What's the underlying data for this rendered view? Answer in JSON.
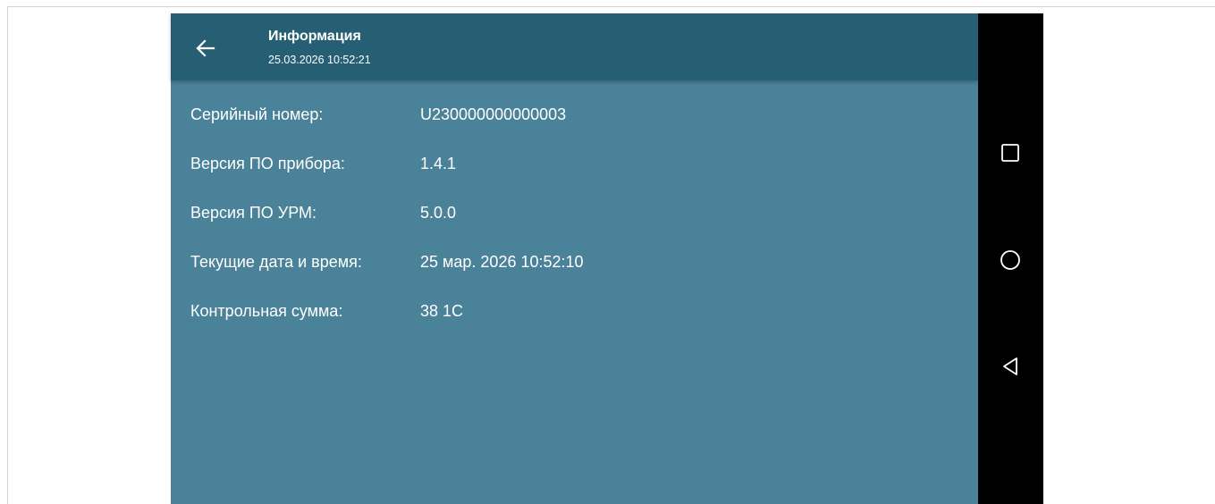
{
  "toolbar": {
    "title": "Информация",
    "subtitle": "25.03.2026 10:52:21",
    "back_icon": "arrow-left-icon"
  },
  "info": {
    "rows": [
      {
        "label": "Серийный номер:",
        "value": "U230000000000003"
      },
      {
        "label": "Версия ПО прибора:",
        "value": "1.4.1"
      },
      {
        "label": "Версия ПО УРМ:",
        "value": "5.0.0"
      },
      {
        "label": "Текущие дата и время:",
        "value": "25 мар. 2026 10:52:10"
      },
      {
        "label": "Контрольная сумма:",
        "value": "38 1C"
      }
    ]
  },
  "navbar": {
    "buttons": [
      "recents-square-icon",
      "home-circle-icon",
      "back-triangle-icon"
    ]
  },
  "colors": {
    "toolbar": "#265f73",
    "content": "#4a8299",
    "navbar": "#000000",
    "text": "#ffffff"
  }
}
